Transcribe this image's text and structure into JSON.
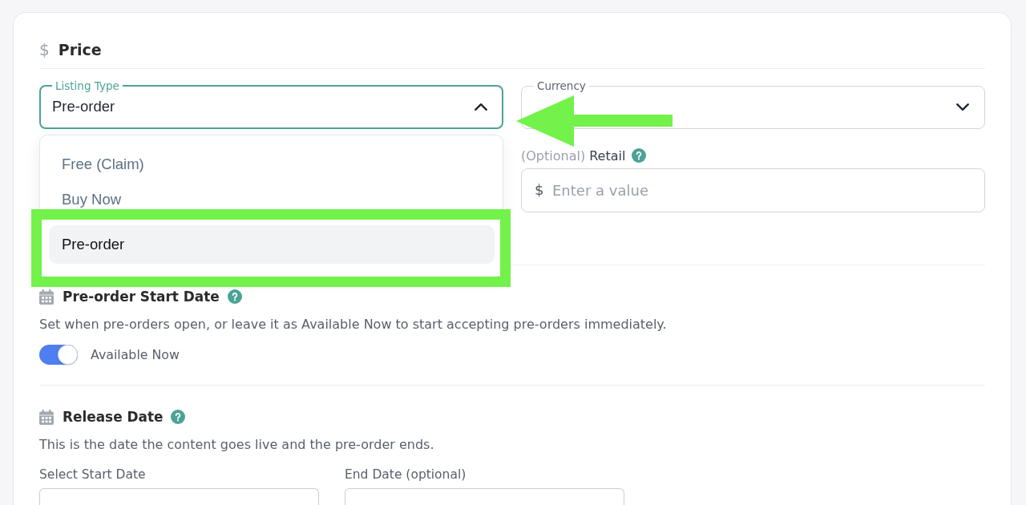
{
  "price_section": {
    "icon": "$",
    "title": "Price"
  },
  "listing_type": {
    "label": "Listing Type",
    "value": "Pre-order",
    "expanded": true,
    "options": [
      {
        "label": "Free (Claim)",
        "selected": false,
        "highlighted": false
      },
      {
        "label": "Buy Now",
        "selected": false,
        "highlighted": false
      },
      {
        "label": "Pre-order",
        "selected": true,
        "highlighted": true
      }
    ]
  },
  "currency": {
    "label": "Currency",
    "expanded": false,
    "pointed_at": true
  },
  "retail": {
    "optional_tag": "(Optional)",
    "label": "Retail",
    "prefix": "$",
    "placeholder": "Enter a value"
  },
  "preorder_start": {
    "title": "Pre-order Start Date",
    "description": "Set when pre-orders open, or leave it as Available Now to start accepting pre-orders immediately.",
    "toggle": {
      "label": "Available Now",
      "on": true
    }
  },
  "release_date": {
    "title": "Release Date",
    "description": "This is the date the content goes live and the pre-order ends.",
    "fields": [
      {
        "label": "Select Start Date"
      },
      {
        "label": "End Date (optional)"
      }
    ]
  }
}
